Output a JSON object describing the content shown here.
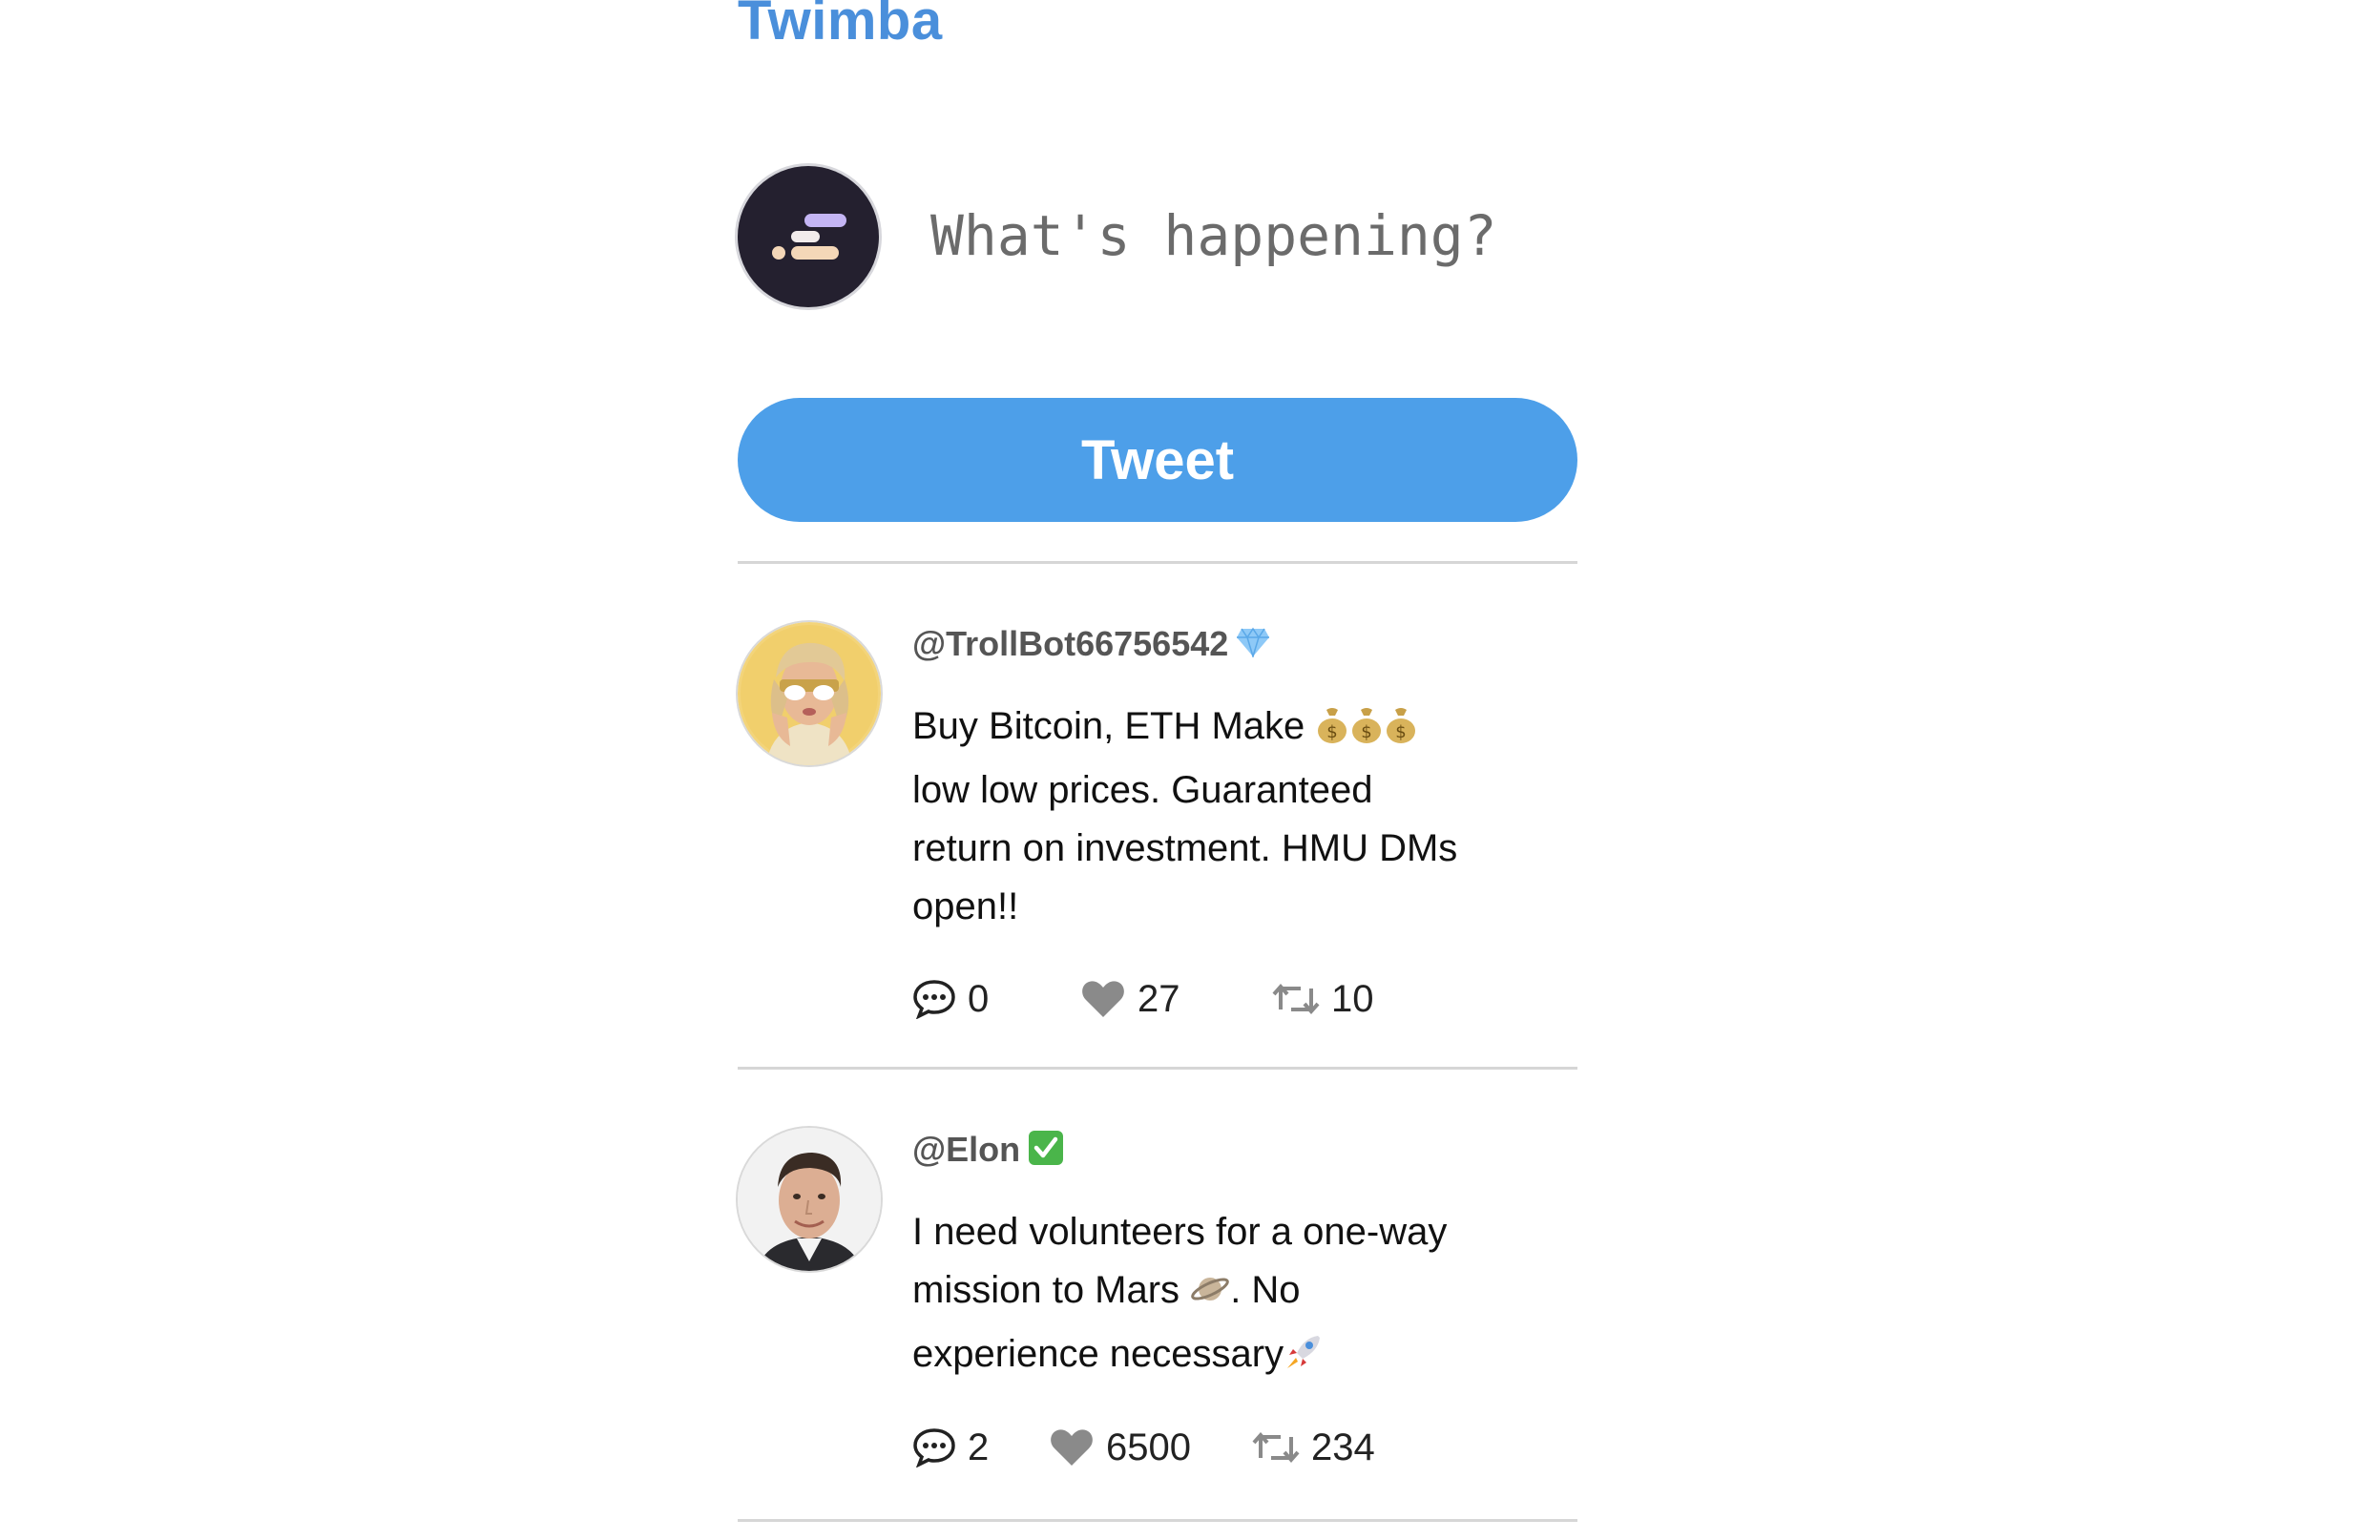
{
  "app": {
    "title": "Twimba"
  },
  "composer": {
    "placeholder": "What's happening?",
    "button_label": "Tweet"
  },
  "feed": [
    {
      "handle": "@TrollBot66756542",
      "badge": "diamond-icon",
      "text_lines": [
        "Buy Bitcoin, ETH Make",
        "low low prices. Guaranteed",
        "return on investment. HMU DMs",
        "open!!"
      ],
      "inline_emoji": [
        "money-bag-icon",
        "money-bag-icon",
        "money-bag-icon"
      ],
      "replies": "0",
      "likes": "27",
      "retweets": "10"
    },
    {
      "handle": "@Elon",
      "badge": "check-mark-icon",
      "text_lines": [
        "I need volunteers for a one-way",
        "mission to Mars",
        ". No",
        "experience necessary"
      ],
      "inline_emoji": [
        "planet-icon",
        "rocket-icon"
      ],
      "replies": "2",
      "likes": "6500",
      "retweets": "234"
    }
  ],
  "colors": {
    "brand": "#4a8fdb",
    "tweet_button": "#4d9fe9",
    "divider": "#d6d6d6",
    "icon_gray": "#7a7a7a"
  }
}
